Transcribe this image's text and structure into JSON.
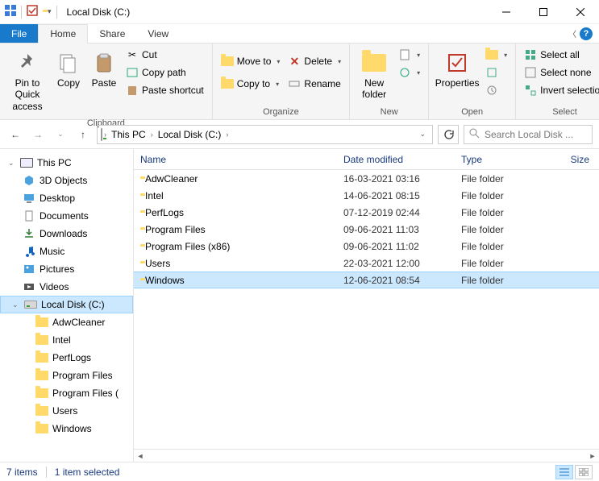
{
  "title": "Local Disk (C:)",
  "tabs": {
    "file": "File",
    "home": "Home",
    "share": "Share",
    "view": "View"
  },
  "ribbon": {
    "clipboard": {
      "label": "Clipboard",
      "pin": "Pin to Quick access",
      "copy": "Copy",
      "paste": "Paste",
      "cut": "Cut",
      "copypath": "Copy path",
      "pasteshortcut": "Paste shortcut"
    },
    "organize": {
      "label": "Organize",
      "moveto": "Move to",
      "copyto": "Copy to",
      "delete": "Delete",
      "rename": "Rename"
    },
    "new": {
      "label": "New",
      "newfolder": "New folder"
    },
    "open": {
      "label": "Open",
      "properties": "Properties"
    },
    "select": {
      "label": "Select",
      "selectall": "Select all",
      "selectnone": "Select none",
      "invert": "Invert selection"
    }
  },
  "breadcrumbs": {
    "thispc": "This PC",
    "disk": "Local Disk (C:)"
  },
  "search_placeholder": "Search Local Disk ...",
  "nav": {
    "thispc": "This PC",
    "objects3d": "3D Objects",
    "desktop": "Desktop",
    "documents": "Documents",
    "downloads": "Downloads",
    "music": "Music",
    "pictures": "Pictures",
    "videos": "Videos",
    "localdisk": "Local Disk (C:)",
    "sub": {
      "adwcleaner": "AdwCleaner",
      "intel": "Intel",
      "perflogs": "PerfLogs",
      "programfiles": "Program Files",
      "programfilesx": "Program Files (",
      "users": "Users",
      "windows": "Windows"
    }
  },
  "columns": {
    "name": "Name",
    "date": "Date modified",
    "type": "Type",
    "size": "Size"
  },
  "files": [
    {
      "name": "AdwCleaner",
      "date": "16-03-2021 03:16",
      "type": "File folder"
    },
    {
      "name": "Intel",
      "date": "14-06-2021 08:15",
      "type": "File folder"
    },
    {
      "name": "PerfLogs",
      "date": "07-12-2019 02:44",
      "type": "File folder"
    },
    {
      "name": "Program Files",
      "date": "09-06-2021 11:03",
      "type": "File folder"
    },
    {
      "name": "Program Files (x86)",
      "date": "09-06-2021 11:02",
      "type": "File folder"
    },
    {
      "name": "Users",
      "date": "22-03-2021 12:00",
      "type": "File folder"
    },
    {
      "name": "Windows",
      "date": "12-06-2021 08:54",
      "type": "File folder"
    }
  ],
  "status": {
    "count": "7 items",
    "selected": "1 item selected"
  }
}
